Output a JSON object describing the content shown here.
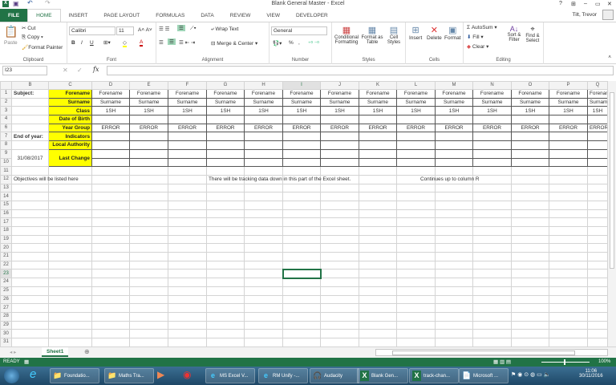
{
  "window": {
    "title": "Blank General Master - Excel",
    "help": "?",
    "minimize": "–",
    "restore": "▭",
    "close": "✕",
    "user": "Tilt, Trevor"
  },
  "tabs": [
    "FILE",
    "HOME",
    "INSERT",
    "PAGE LAYOUT",
    "FORMULAS",
    "DATA",
    "REVIEW",
    "VIEW",
    "DEVELOPER"
  ],
  "ribbon": {
    "clipboard": {
      "label": "Clipboard",
      "paste": "Paste",
      "cut": "Cut",
      "copy": "Copy",
      "format_painter": "Format Painter"
    },
    "font": {
      "label": "Font",
      "name": "Calibri",
      "size": "11",
      "bold": "B",
      "italic": "I",
      "underline": "U"
    },
    "alignment": {
      "label": "Alignment",
      "wrap": "Wrap Text",
      "merge": "Merge & Center"
    },
    "number": {
      "label": "Number",
      "format": "General",
      "percent": "%",
      "comma": ","
    },
    "styles": {
      "label": "Styles",
      "conditional": "Conditional Formatting",
      "format_table": "Format as Table",
      "cell_styles": "Cell Styles"
    },
    "cells": {
      "label": "Cells",
      "insert": "Insert",
      "delete": "Delete",
      "format": "Format"
    },
    "editing": {
      "label": "Editing",
      "autosum": "AutoSum",
      "fill": "Fill",
      "clear": "Clear",
      "sort": "Sort & Filter",
      "find": "Find & Select"
    }
  },
  "formula_bar": {
    "name_box": "I23",
    "fx": "fx",
    "value": ""
  },
  "sheet": {
    "columns": [
      "B",
      "C",
      "D",
      "E",
      "F",
      "G",
      "H",
      "I",
      "J",
      "K",
      "L",
      "M",
      "N",
      "O",
      "P",
      "Q"
    ],
    "rows": [
      "1",
      "2",
      "3",
      "4",
      "6",
      "7",
      "8",
      "9",
      "10",
      "11",
      "12",
      "13",
      "14",
      "15",
      "16",
      "17",
      "18",
      "19",
      "20",
      "21",
      "22",
      "23",
      "24",
      "25",
      "26",
      "27",
      "28",
      "29",
      "30",
      "31"
    ],
    "labels": {
      "subject": "Subject:",
      "end_of_year": "End of year:",
      "date": "31/08/2017"
    },
    "row_headers": [
      "Forename",
      "Surname",
      "Class",
      "Date of Birth",
      "Year Group",
      "Indicators",
      "Local Authority",
      "Last Change"
    ],
    "student_values": {
      "forename": "Forename",
      "surname": "Surname",
      "class": "1SH",
      "year_group": "ERROR"
    },
    "notes": {
      "b12": "Objectives will be listed here",
      "g12": "There will be tracking data down in this part of the Excel sheet.",
      "l12": "Continues up to column R"
    },
    "selected_cell": "I23"
  },
  "sheet_tabs": [
    "Sheet1"
  ],
  "status": {
    "ready": "READY",
    "zoom": "100%"
  },
  "taskbar": {
    "items": [
      "Foundatio...",
      "Maths Tra...",
      "MS Excel V...",
      "RM Unify -...",
      "Audacity",
      "Blank Gen...",
      "track-chan...",
      "Microsoft ..."
    ],
    "time": "11:06",
    "date": "30/11/2016"
  }
}
